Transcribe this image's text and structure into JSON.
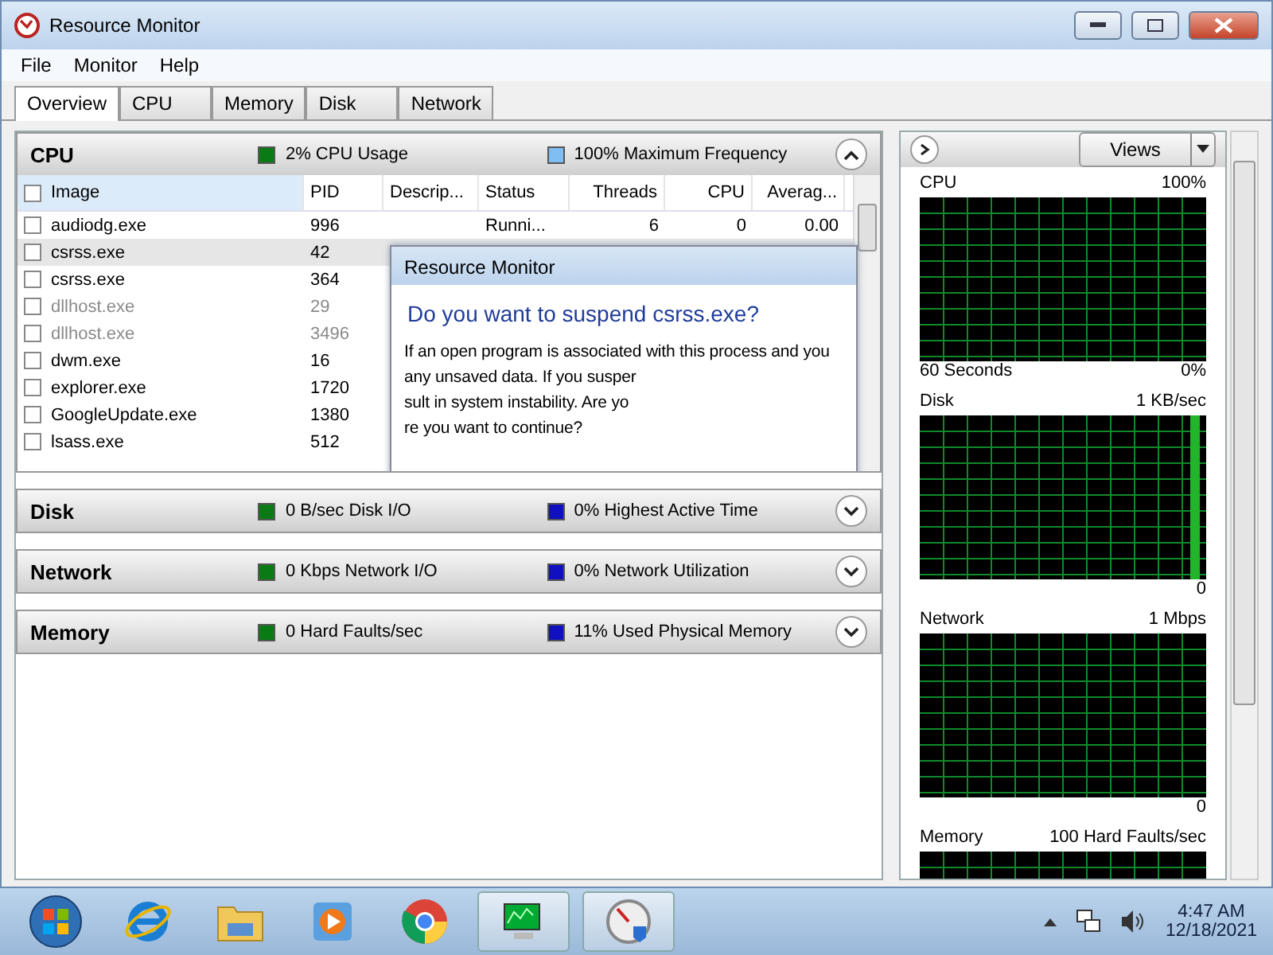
{
  "window": {
    "title": "Resource Monitor"
  },
  "menu": [
    "File",
    "Monitor",
    "Help"
  ],
  "tabs": [
    {
      "label": "Overview",
      "selected": true
    },
    {
      "label": "CPU",
      "selected": false
    },
    {
      "label": "Memory",
      "selected": false
    },
    {
      "label": "Disk",
      "selected": false
    },
    {
      "label": "Network",
      "selected": false
    }
  ],
  "sections": [
    {
      "title": "CPU",
      "expanded": true,
      "stats": [
        {
          "text": "2% CPU Usage",
          "color": "#0a7a14"
        },
        {
          "text": "100% Maximum Frequency",
          "color": "#7fbdf2"
        }
      ]
    },
    {
      "title": "Disk",
      "expanded": false,
      "stats": [
        {
          "text": "0 B/sec Disk I/O",
          "color": "#0a7a14"
        },
        {
          "text": "0% Highest Active Time",
          "color": "#1010c0"
        }
      ]
    },
    {
      "title": "Network",
      "expanded": false,
      "stats": [
        {
          "text": "0 Kbps Network I/O",
          "color": "#0a7a14"
        },
        {
          "text": "0% Network Utilization",
          "color": "#1010c0"
        }
      ]
    },
    {
      "title": "Memory",
      "expanded": false,
      "stats": [
        {
          "text": "0 Hard Faults/sec",
          "color": "#0a7a14"
        },
        {
          "text": "11% Used Physical Memory",
          "color": "#1010c0"
        }
      ]
    }
  ],
  "cpu_table": {
    "select_all_checked": false,
    "columns": [
      "Image",
      "PID",
      "Descrip...",
      "Status",
      "Threads",
      "CPU",
      "Averag..."
    ],
    "rows": [
      {
        "checked": false,
        "selected": false,
        "dimmed": false,
        "cells": [
          "audiodg.exe",
          "996",
          "",
          "Runni...",
          "6",
          "0",
          "0.00"
        ]
      },
      {
        "checked": false,
        "selected": true,
        "dimmed": false,
        "cells": [
          "csrss.exe",
          "42"
        ]
      },
      {
        "checked": false,
        "selected": false,
        "dimmed": false,
        "cells": [
          "csrss.exe",
          "364"
        ]
      },
      {
        "checked": false,
        "selected": false,
        "dimmed": true,
        "cells": [
          "dllhost.exe",
          "29"
        ]
      },
      {
        "checked": false,
        "selected": false,
        "dimmed": true,
        "cells": [
          "dllhost.exe",
          "3496"
        ]
      },
      {
        "checked": false,
        "selected": false,
        "dimmed": false,
        "cells": [
          "dwm.exe",
          "16"
        ]
      },
      {
        "checked": false,
        "selected": false,
        "dimmed": false,
        "cells": [
          "explorer.exe",
          "1720"
        ]
      },
      {
        "checked": false,
        "selected": false,
        "dimmed": false,
        "cells": [
          "GoogleUpdate.exe",
          "1380"
        ]
      },
      {
        "checked": false,
        "selected": false,
        "dimmed": false,
        "cells": [
          "lsass.exe",
          "512"
        ]
      }
    ]
  },
  "dialog": {
    "title": "Resource Monitor",
    "heading": "Do you want to suspend csrss.exe?",
    "lines": [
      "If an open program is associated with this process and you",
      "any unsaved data. If you susper",
      "sult in system instability. Are yo",
      "re you want to continue?"
    ]
  },
  "side_panel": {
    "views_button": "Views",
    "graphs": [
      {
        "title": "CPU",
        "max": "100%",
        "footer": "60 Seconds",
        "min": "0%",
        "activity": false
      },
      {
        "title": "Disk",
        "max": "1 KB/sec",
        "min": "0",
        "activity": true
      },
      {
        "title": "Network",
        "max": "1 Mbps",
        "min": "0",
        "activity": false
      },
      {
        "title": "Memory",
        "max": "100 Hard Faults/sec",
        "activity": false
      }
    ]
  },
  "taskbar": {
    "time": "4:47 AM",
    "date": "12/18/2021"
  }
}
